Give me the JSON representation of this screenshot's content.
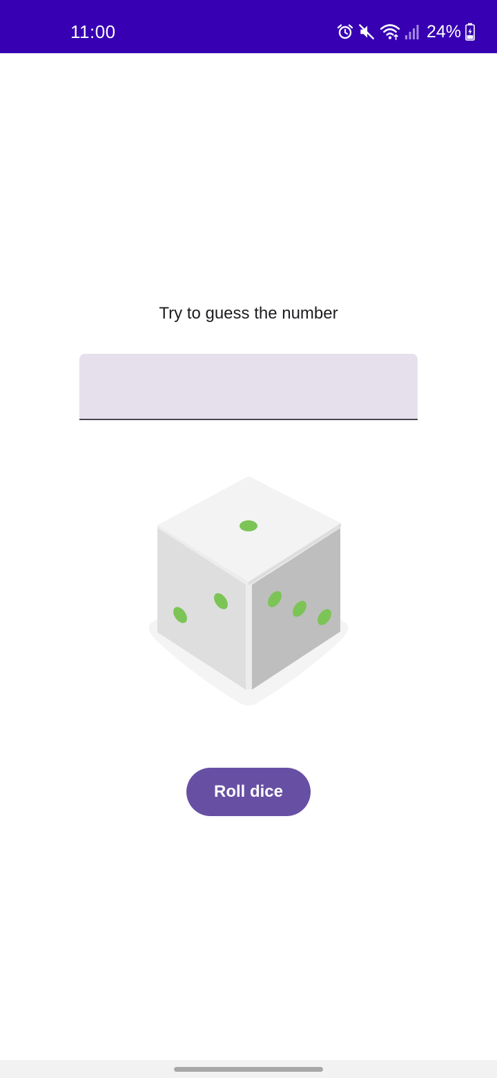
{
  "status_bar": {
    "time": "11:00",
    "battery": "24%",
    "background": "#3700b3",
    "icons": [
      "alarm-icon",
      "mute-icon",
      "wifi-icon",
      "signal-icon",
      "battery-charging-icon"
    ]
  },
  "main": {
    "prompt": "Try to guess the number",
    "guess_input": {
      "value": "",
      "placeholder": ""
    },
    "dice": {
      "icon": "dice-icon",
      "visible_faces": [
        1,
        2,
        3
      ],
      "pip_color": "#7cc456"
    },
    "roll_button": {
      "label": "Roll dice",
      "color": "#6750a4"
    }
  },
  "nav_bar": {
    "icon": "home-handle"
  }
}
